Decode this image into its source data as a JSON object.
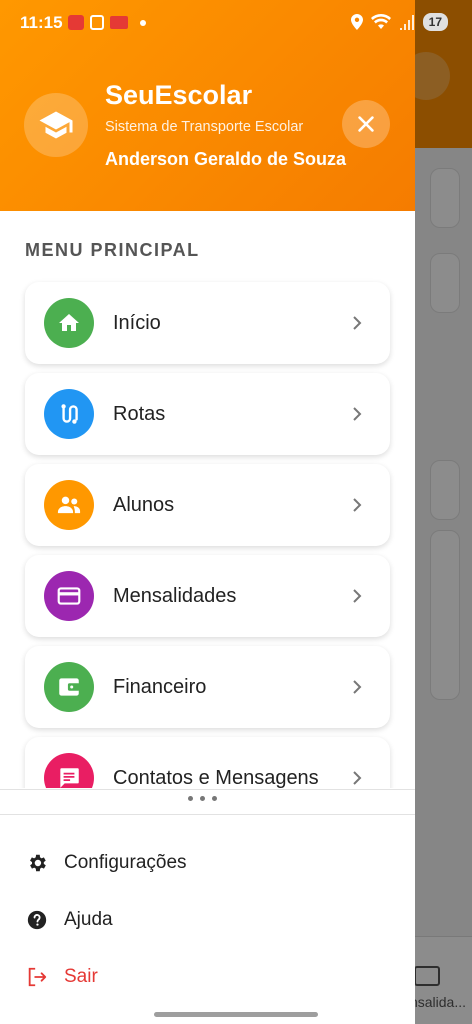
{
  "status_bar": {
    "time": "11:15",
    "battery": "17"
  },
  "drawer": {
    "app_name": "SeuEscolar",
    "app_subtitle": "Sistema de Transporte Escolar",
    "user_name": "Anderson Geraldo de Souza",
    "section_title": "MENU PRINCIPAL",
    "menu_items": [
      {
        "label": "Início",
        "icon": "home-icon",
        "color": "#4caf50"
      },
      {
        "label": "Rotas",
        "icon": "route-icon",
        "color": "#2196f3"
      },
      {
        "label": "Alunos",
        "icon": "people-icon",
        "color": "#ff9800"
      },
      {
        "label": "Mensalidades",
        "icon": "credit-card-icon",
        "color": "#9c27b0"
      },
      {
        "label": "Financeiro",
        "icon": "wallet-icon",
        "color": "#4caf50"
      },
      {
        "label": "Contatos e Mensagens",
        "icon": "message-icon",
        "color": "#e91e63"
      }
    ],
    "bottom_items": [
      {
        "label": "Configurações",
        "icon": "gear-icon"
      },
      {
        "label": "Ajuda",
        "icon": "help-icon"
      },
      {
        "label": "Sair",
        "icon": "logout-icon"
      }
    ]
  },
  "background": {
    "bottom_nav_label": "nsalida..."
  },
  "colors": {
    "accent": "#ff9800",
    "danger": "#e53935"
  }
}
